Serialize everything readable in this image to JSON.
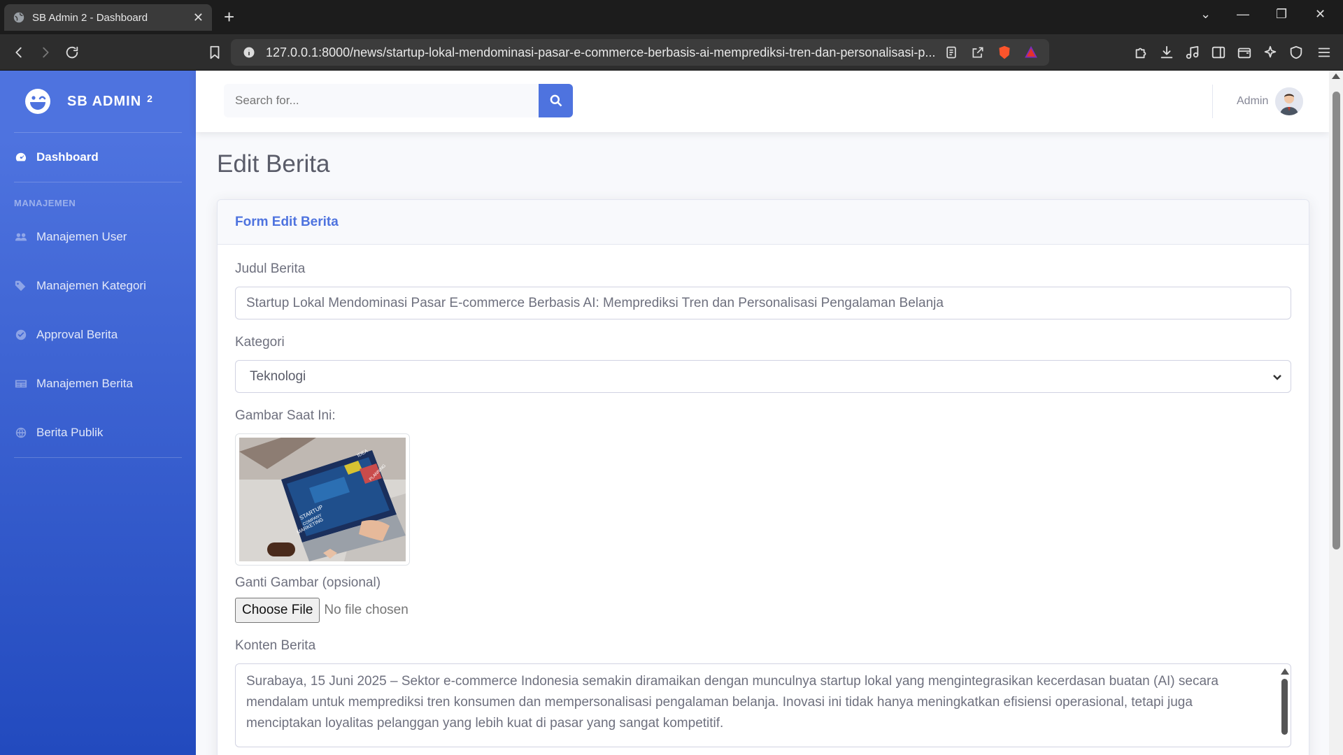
{
  "browser": {
    "tab_title": "SB Admin 2 - Dashboard",
    "tab_close": "✕",
    "new_tab": "+",
    "url": "127.0.0.1:8000/news/startup-lokal-mendominasi-pasar-e-commerce-berbasis-ai-memprediksi-tren-dan-personalisasi-p...",
    "window_controls": {
      "dropdown": "⌄",
      "minimize": "—",
      "restore": "❐",
      "close": "✕"
    }
  },
  "sidebar": {
    "brand": "SB ADMIN",
    "brand_sup": "2",
    "dashboard": "Dashboard",
    "heading": "MANAJEMEN",
    "items": [
      {
        "label": "Manajemen User",
        "icon": "users-icon"
      },
      {
        "label": "Manajemen Kategori",
        "icon": "tags-icon"
      },
      {
        "label": "Approval Berita",
        "icon": "check-circle-icon"
      },
      {
        "label": "Manajemen Berita",
        "icon": "newspaper-icon"
      },
      {
        "label": "Berita Publik",
        "icon": "globe-icon"
      }
    ]
  },
  "topbar": {
    "search_placeholder": "Search for...",
    "user_name": "Admin"
  },
  "page": {
    "title": "Edit Berita",
    "card_title": "Form Edit Berita",
    "fields": {
      "judul_label": "Judul Berita",
      "judul_value": "Startup Lokal Mendominasi Pasar E-commerce Berbasis AI: Memprediksi Tren dan Personalisasi Pengalaman Belanja",
      "kategori_label": "Kategori",
      "kategori_value": "Teknologi",
      "gambar_label": "Gambar Saat Ini:",
      "ganti_label": "Ganti Gambar (opsional)",
      "file_button": "Choose File",
      "file_status": "No file chosen",
      "konten_label": "Konten Berita",
      "konten_value": "Surabaya, 15 Juni 2025 – Sektor e-commerce Indonesia semakin diramaikan dengan munculnya startup lokal yang mengintegrasikan kecerdasan buatan (AI) secara mendalam untuk memprediksi tren konsumen dan mempersonalisasi pengalaman belanja. Inovasi ini tidak hanya meningkatkan efisiensi operasional, tetapi juga menciptakan loyalitas pelanggan yang lebih kuat di pasar yang sangat kompetitif."
    },
    "image_text": {
      "line1": "STARTUP",
      "line2": "COMPANY",
      "line3": "MARKETING",
      "idea": "IDEA",
      "planning": "PLANNING"
    }
  },
  "colors": {
    "primary": "#4e73df",
    "sidebar_end": "#224abe"
  }
}
